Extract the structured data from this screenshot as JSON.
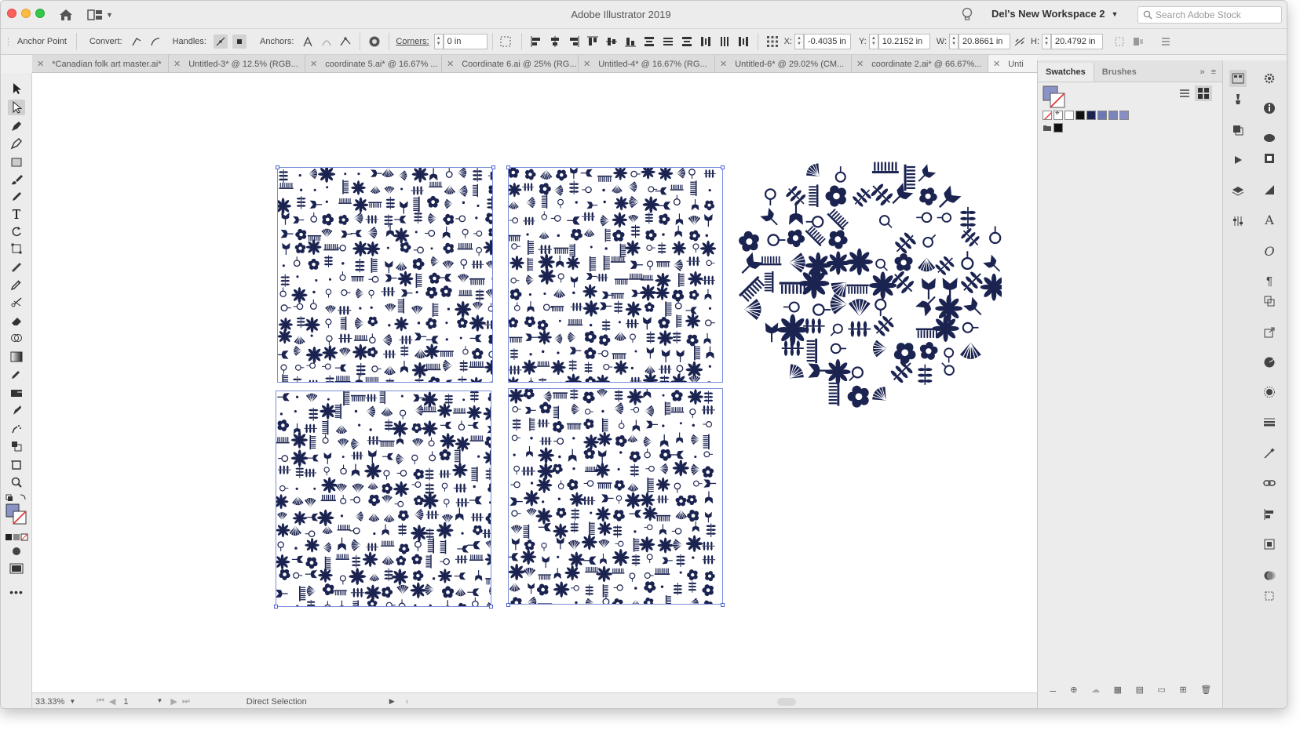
{
  "window": {
    "title": "Adobe Illustrator 2019",
    "workspace": "Del's New Workspace 2",
    "search_placeholder": "Search Adobe Stock"
  },
  "control_bar": {
    "selection_label": "Anchor Point",
    "convert_label": "Convert:",
    "handles_label": "Handles:",
    "anchors_label": "Anchors:",
    "corners_label": "Corners:",
    "corners_value": "0 in",
    "x_label": "X:",
    "x_value": "-0.4035 in",
    "y_label": "Y:",
    "y_value": "10.2152 in",
    "w_label": "W:",
    "w_value": "20.8661 in",
    "h_label": "H:",
    "h_value": "20.4792 in"
  },
  "tabs": [
    {
      "label": "*Canadian folk art master.ai*"
    },
    {
      "label": "Untitled-3* @ 12.5% (RGB..."
    },
    {
      "label": "coordinate 5.ai* @ 16.67% ..."
    },
    {
      "label": "Coordinate 6.ai @ 25% (RG..."
    },
    {
      "label": "Untitled-4* @ 16.67% (RG..."
    },
    {
      "label": "Untitled-6* @ 29.02% (CM..."
    },
    {
      "label": "coordinate 2.ai* @ 66.67%..."
    },
    {
      "label": "Unti"
    }
  ],
  "status_bar": {
    "zoom": "33.33%",
    "artboard_number": "1",
    "current_tool": "Direct Selection"
  },
  "swatches_panel": {
    "tabs": [
      "Swatches",
      "Brushes"
    ],
    "colors": {
      "navy": "#1b2350",
      "black": "#111111",
      "pattern": "#6c77b5"
    }
  },
  "colors": {
    "ink": "#1b2350",
    "selection": "#4a63d6"
  }
}
